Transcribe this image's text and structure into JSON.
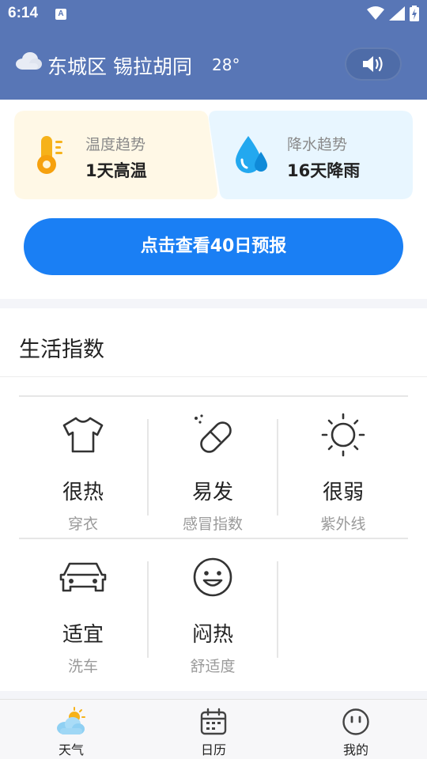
{
  "status_bar": {
    "time": "6:14",
    "notification_glyph": "A"
  },
  "header": {
    "location": "东城区 锡拉胡同",
    "temperature": "28°",
    "sound_button_icon": "speaker-icon"
  },
  "trends": {
    "temperature": {
      "label": "温度趋势",
      "value": "1天高温",
      "bg": "#fff8e6"
    },
    "precipitation": {
      "label": "降水趋势",
      "value": "16天降雨",
      "bg": "#e8f6ff"
    }
  },
  "forecast_button": {
    "label": "点击查看40日预报",
    "color": "#1a7ff4"
  },
  "life_index": {
    "title": "生活指数",
    "items": [
      {
        "value": "很热",
        "name": "穿衣",
        "icon": "tshirt-icon"
      },
      {
        "value": "易发",
        "name": "感冒指数",
        "icon": "pill-icon"
      },
      {
        "value": "很弱",
        "name": "紫外线",
        "icon": "sun-icon"
      },
      {
        "value": "适宜",
        "name": "洗车",
        "icon": "car-icon"
      },
      {
        "value": "闷热",
        "name": "舒适度",
        "icon": "smiley-icon"
      }
    ]
  },
  "bottom_nav": [
    {
      "label": "天气",
      "icon": "weather-icon",
      "active": true
    },
    {
      "label": "日历",
      "icon": "calendar-icon",
      "active": false
    },
    {
      "label": "我的",
      "icon": "profile-icon",
      "active": false
    }
  ],
  "colors": {
    "header_bg": "#5876b6",
    "accent": "#1a7ff4"
  }
}
